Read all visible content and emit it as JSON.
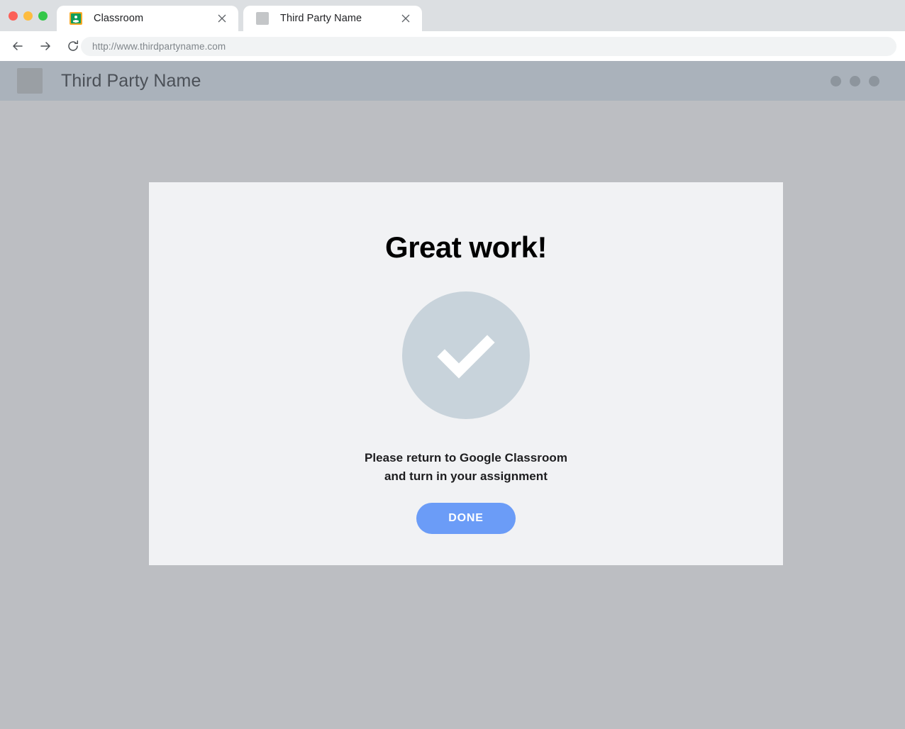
{
  "browser": {
    "traffic_lights": [
      {
        "name": "close",
        "color": "#fc6058"
      },
      {
        "name": "minimize",
        "color": "#fdbc40"
      },
      {
        "name": "maximize",
        "color": "#34c749"
      }
    ],
    "tabs": [
      {
        "title": "Classroom",
        "favicon": "google-classroom-icon",
        "active": false,
        "close_label": "×"
      },
      {
        "title": "Third Party Name",
        "favicon": "placeholder-favicon",
        "active": true,
        "close_label": "×"
      }
    ],
    "nav": {
      "back_label": "←",
      "forward_label": "→",
      "reload_label": "↻"
    },
    "url": "http://www.thirdpartyname.com"
  },
  "site_header": {
    "title": "Third Party Name",
    "logo": "logo-placeholder",
    "menu_dots": 3,
    "bg_color": "#aab2bb"
  },
  "card": {
    "title": "Great work!",
    "status_icon": "check-circle-icon",
    "message_line_1": "Please return to Google Classroom",
    "message_line_2": "and turn in your assignment",
    "button_label": "DONE",
    "button_color": "#6b9cf7",
    "bg_color": "#f1f2f4",
    "check_circle_color": "#c8d3db"
  },
  "page": {
    "bg_color": "#bcbec2"
  }
}
